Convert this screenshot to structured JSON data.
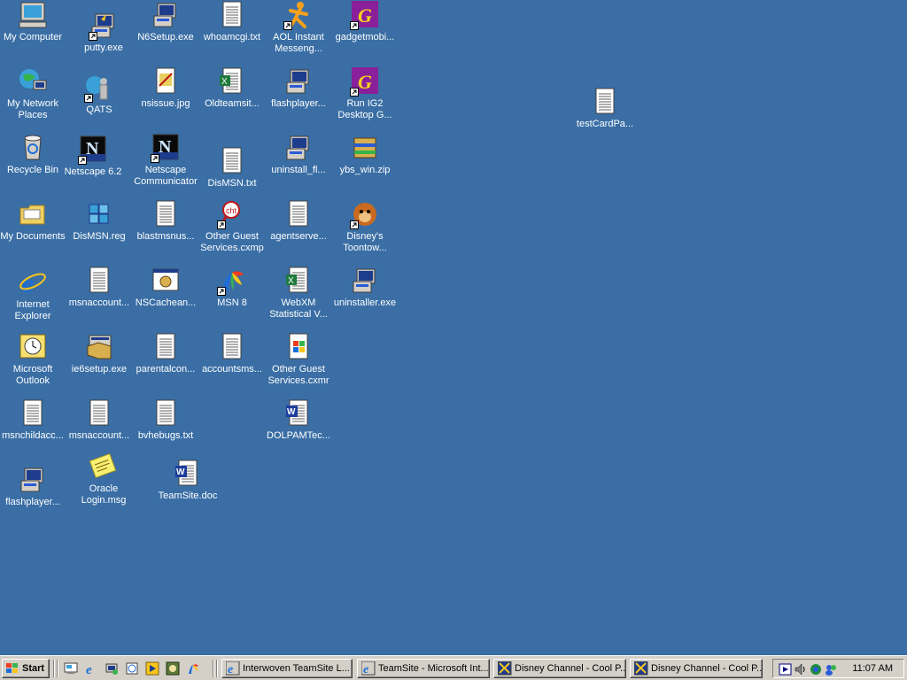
{
  "desktop_icons": [
    {
      "name": "my-computer-icon",
      "label": "My Computer",
      "type": "computer"
    },
    {
      "name": "putty-exe-icon",
      "label": "putty.exe",
      "type": "putty"
    },
    {
      "name": "n6setup-exe-icon",
      "label": "N6Setup.exe",
      "type": "setup"
    },
    {
      "name": "whoamcgi-txt-icon",
      "label": "whoamcgi.txt",
      "type": "txt"
    },
    {
      "name": "aol-instant-messenger-icon",
      "label": "AOL Instant Messeng...",
      "type": "aim"
    },
    {
      "name": "gadgetmobi-icon",
      "label": "gadgetmobi...",
      "type": "g"
    },
    {
      "name": "my-network-places-icon",
      "label": "My Network Places",
      "type": "network"
    },
    {
      "name": "qats-icon",
      "label": "QATS",
      "type": "qats"
    },
    {
      "name": "nsissue-jpg-icon",
      "label": "nsissue.jpg",
      "type": "jpg"
    },
    {
      "name": "oldteamsite-icon",
      "label": "Oldteamsit...",
      "type": "xls"
    },
    {
      "name": "flashplayer-icon",
      "label": "flashplayer...",
      "type": "setup"
    },
    {
      "name": "run-ig2-icon",
      "label": "Run IG2 Desktop G...",
      "type": "g"
    },
    {
      "name": "test-card-icon",
      "label": "testCardPa...",
      "type": "txt"
    },
    {
      "name": "recycle-bin-icon",
      "label": "Recycle Bin",
      "type": "recycle"
    },
    {
      "name": "netscape-62-icon",
      "label": "Netscape 6.2",
      "type": "netscape"
    },
    {
      "name": "netscape-communicator-icon",
      "label": "Netscape Communicator",
      "type": "netscape"
    },
    {
      "name": "dismsn-txt-icon",
      "label": "DisMSN.txt",
      "type": "txt"
    },
    {
      "name": "uninstall-fl-icon",
      "label": "uninstall_fl...",
      "type": "setup"
    },
    {
      "name": "ybs-win-zip-icon",
      "label": "ybs_win.zip",
      "type": "zip"
    },
    {
      "name": "my-documents-icon",
      "label": "My Documents",
      "type": "folder"
    },
    {
      "name": "dismsn-reg-icon",
      "label": "DisMSN.reg",
      "type": "reg"
    },
    {
      "name": "blastmsnus-icon",
      "label": "blastmsnus...",
      "type": "txt"
    },
    {
      "name": "other-guest-cxmp-icon",
      "label": "Other Guest Services.cxmp",
      "type": "cxmp"
    },
    {
      "name": "agentserve-icon",
      "label": "agentserve...",
      "type": "txt"
    },
    {
      "name": "disneys-toontown-icon",
      "label": "Disney's Toontow...",
      "type": "toontown"
    },
    {
      "name": "internet-explorer-icon",
      "label": "Internet Explorer",
      "type": "ie"
    },
    {
      "name": "msnaccount-icon",
      "label": "msnaccount...",
      "type": "txt"
    },
    {
      "name": "nscachean-icon",
      "label": "NSCachean...",
      "type": "app"
    },
    {
      "name": "msn8-icon",
      "label": "MSN 8",
      "type": "msn"
    },
    {
      "name": "webxm-statistical-icon",
      "label": "WebXM Statistical V...",
      "type": "xls"
    },
    {
      "name": "uninstaller-exe-icon",
      "label": "uninstaller.exe",
      "type": "setup"
    },
    {
      "name": "microsoft-outlook-icon",
      "label": "Microsoft Outlook",
      "type": "outlook"
    },
    {
      "name": "ie6setup-exe-icon",
      "label": "ie6setup.exe",
      "type": "box"
    },
    {
      "name": "parentalcon-icon",
      "label": "parentalcon...",
      "type": "txt"
    },
    {
      "name": "accountsms-icon",
      "label": "accountsms...",
      "type": "txt"
    },
    {
      "name": "other-guest-cxmr-icon",
      "label": "Other Guest Services.cxmr",
      "type": "win"
    },
    {
      "name": "msnchildacc-icon",
      "label": "msnchildacc...",
      "type": "txt"
    },
    {
      "name": "msnaccount2-icon",
      "label": "msnaccount...",
      "type": "txt"
    },
    {
      "name": "bvhebugs-txt-icon",
      "label": "bvhebugs.txt",
      "type": "txt"
    },
    {
      "name": "dolpamtec-icon",
      "label": "DOLPAMTec...",
      "type": "doc"
    },
    {
      "name": "flashplayer2-icon",
      "label": "flashplayer...",
      "type": "setup"
    },
    {
      "name": "oracle-login-msg-icon",
      "label": "Oracle Login.msg",
      "type": "note"
    },
    {
      "name": "teamsite-doc-icon",
      "label": "TeamSite.doc",
      "type": "doc"
    }
  ],
  "taskbar": {
    "start_label": "Start",
    "quick_launch": [
      "desktop-icon",
      "ie-icon",
      "network-icon",
      "outlook-icon",
      "media-icon",
      "app-icon",
      "msn-icon"
    ],
    "tasks": [
      {
        "label": "Interwoven TeamSite L...",
        "icon": "ie"
      },
      {
        "label": "TeamSite - Microsoft Int...",
        "icon": "ie"
      },
      {
        "label": "Disney Channel - Cool P...",
        "icon": "netscape"
      },
      {
        "label": "Disney Channel - Cool P...",
        "icon": "netscape"
      }
    ],
    "clock": "11:07 AM"
  },
  "colors": {
    "desktop": "#3a6ea5",
    "taskbar": "#d4d0c8"
  }
}
